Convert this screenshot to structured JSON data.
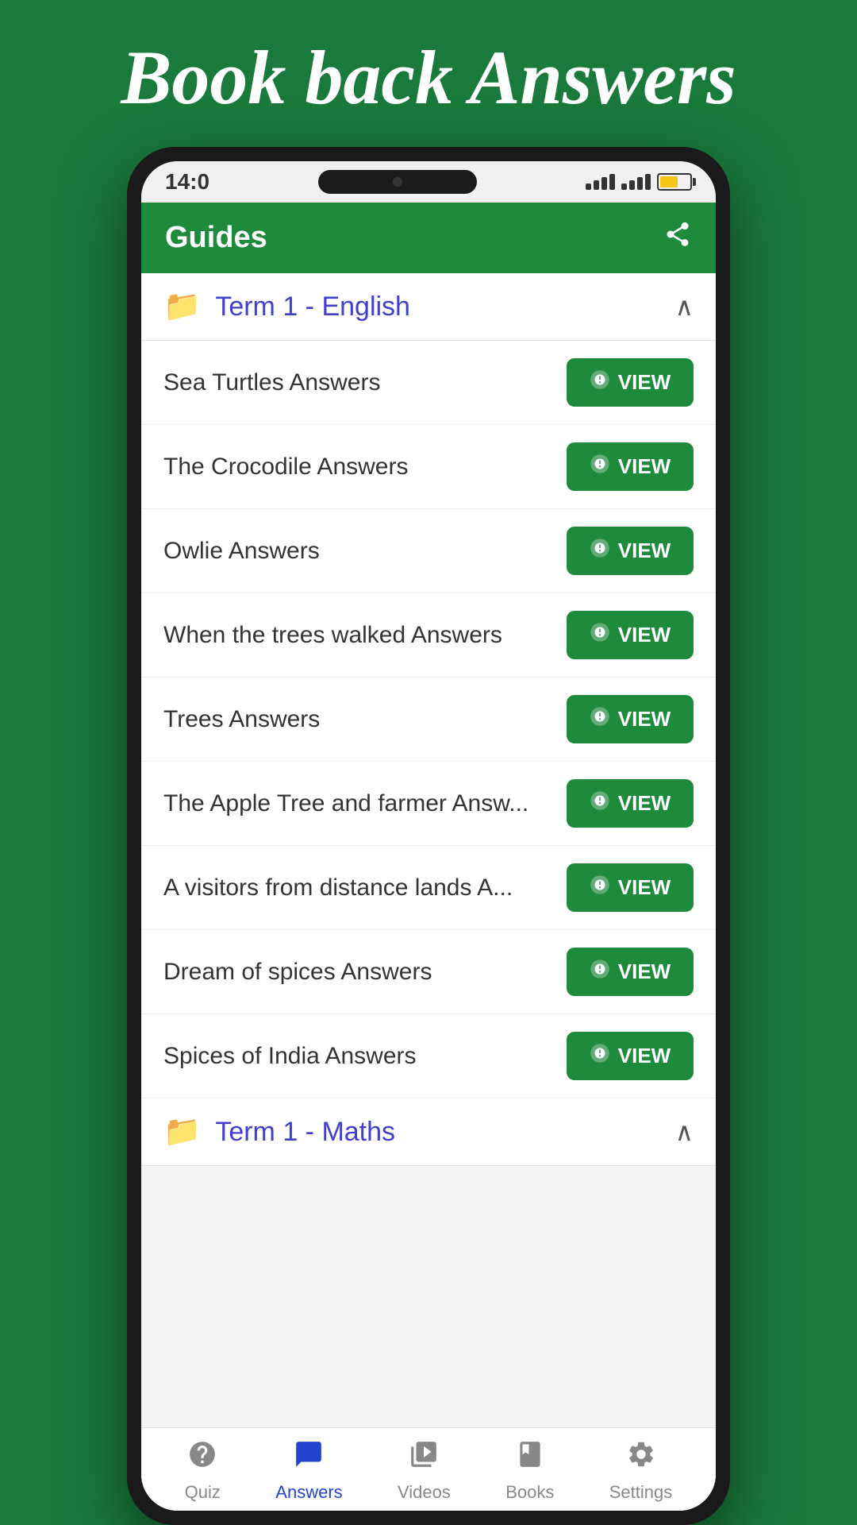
{
  "pageTitle": "Book back Answers",
  "appHeader": {
    "title": "Guides",
    "shareIcon": "⤴"
  },
  "statusBar": {
    "time": "14:0",
    "batteryLevel": 60
  },
  "sections": [
    {
      "id": "term1-english",
      "title": "Term 1 - English",
      "expanded": true,
      "items": [
        {
          "id": 1,
          "label": "Sea Turtles Answers"
        },
        {
          "id": 2,
          "label": "The Crocodile Answers"
        },
        {
          "id": 3,
          "label": "Owlie Answers"
        },
        {
          "id": 4,
          "label": "When the trees walked Answers"
        },
        {
          "id": 5,
          "label": "Trees Answers"
        },
        {
          "id": 6,
          "label": "The Apple Tree and farmer Answ..."
        },
        {
          "id": 7,
          "label": "A visitors from distance lands A..."
        },
        {
          "id": 8,
          "label": "Dream of spices Answers"
        },
        {
          "id": 9,
          "label": "Spices of India Answers"
        }
      ]
    },
    {
      "id": "term1-maths",
      "title": "Term 1 - Maths",
      "expanded": false,
      "items": []
    }
  ],
  "viewButton": {
    "label": "VIEW",
    "coinIcon": "🪙"
  },
  "bottomNav": [
    {
      "id": "quiz",
      "label": "Quiz",
      "icon": "❓",
      "active": false
    },
    {
      "id": "answers",
      "label": "Answers",
      "icon": "💬",
      "active": true
    },
    {
      "id": "videos",
      "label": "Videos",
      "icon": "▶",
      "active": false
    },
    {
      "id": "books",
      "label": "Books",
      "icon": "📖",
      "active": false
    },
    {
      "id": "settings",
      "label": "Settings",
      "icon": "⚙",
      "active": false
    }
  ]
}
